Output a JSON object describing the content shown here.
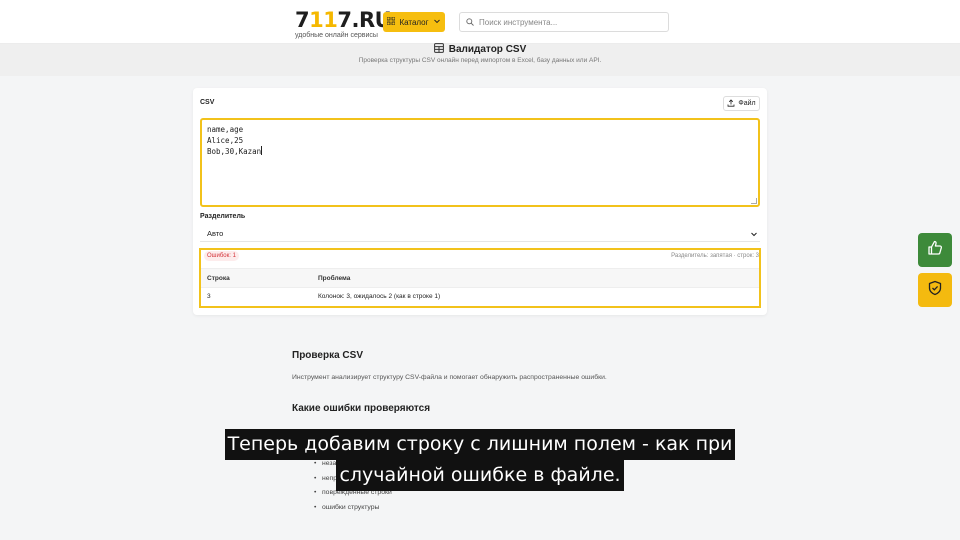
{
  "header": {
    "logo_prefix": "7",
    "logo_accent": "11",
    "logo_suffix": "7.RU",
    "logo_tagline": "удобные онлайн сервисы",
    "catalog_label": "Каталог",
    "search_placeholder": "Поиск инструмента..."
  },
  "page": {
    "title": "Валидатор CSV",
    "subtitle": "Проверка структуры CSV онлайн перед импортом в Excel, базу данных или API."
  },
  "tool": {
    "csv_label": "CSV",
    "file_button": "Файл",
    "csv_lines": [
      "name,age",
      "Alice,25",
      "Bob,30,Kazan"
    ],
    "delimiter_label": "Разделитель",
    "delimiter_value": "Авто",
    "errors_badge": "Ошибок: 1",
    "summary": "Разделитель: запятая · строк: 3",
    "table": {
      "headers": [
        "Строка",
        "Проблема"
      ],
      "rows": [
        {
          "line": "3",
          "problem": "Колонок: 3, ожидалось 2 (как в строке 1)"
        }
      ]
    }
  },
  "article": {
    "h1": "Проверка CSV",
    "intro": "Инструмент анализирует структуру CSV-файла и помогает обнаружить распространенные ошибки.",
    "h2": "Какие ошибки проверяются",
    "list": [
      "незак",
      "непра",
      "поврежденные строки",
      "ошибки структуры"
    ]
  },
  "caption": {
    "line1": "Теперь добавим строку с лишним полем - как при",
    "line2": "случайной ошибке в файле."
  },
  "colors": {
    "accent": "#f6be0f",
    "like_button": "#3d8a3a",
    "highlight_border": "#f2c21b",
    "error_red": "#d4333a"
  },
  "icons": [
    "catalog-grid-icon",
    "chevron-down-icon",
    "search-icon",
    "table-icon",
    "upload-icon",
    "thumbs-up-icon",
    "shield-check-icon"
  ]
}
